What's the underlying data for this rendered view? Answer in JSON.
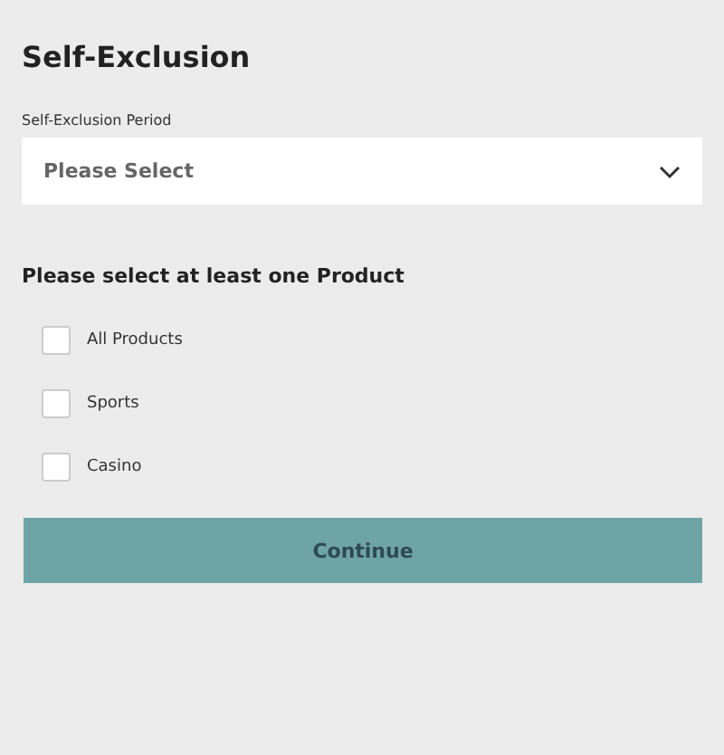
{
  "title": "Self-Exclusion",
  "period": {
    "label": "Self-Exclusion Period",
    "placeholder": "Please Select"
  },
  "products": {
    "heading": "Please select at least one Product",
    "options": [
      {
        "label": "All Products",
        "checked": false
      },
      {
        "label": "Sports",
        "checked": false
      },
      {
        "label": "Casino",
        "checked": false
      }
    ]
  },
  "button": "Continue"
}
